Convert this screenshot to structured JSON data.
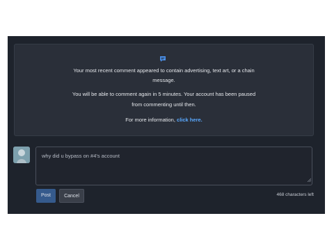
{
  "notice": {
    "icon": "comment-icon",
    "line1": "Your most recent comment appeared to contain advertising, text art, or a chain",
    "line2": "message.",
    "line3": "You will be able to comment again in 5 minutes. Your account has been paused",
    "line4": "from commenting until then.",
    "info_prefix": "For more information,",
    "info_link": "click here."
  },
  "composer": {
    "avatar": "user-avatar",
    "comment_text": "why did u bypass on #4's account",
    "post_label": "Post",
    "cancel_label": "Cancel",
    "chars_left": "468 characters left"
  },
  "colors": {
    "panel": "#1e232c",
    "notice_bg": "#2a2f39",
    "link": "#5aa9ff",
    "post_button": "#355a8c"
  }
}
